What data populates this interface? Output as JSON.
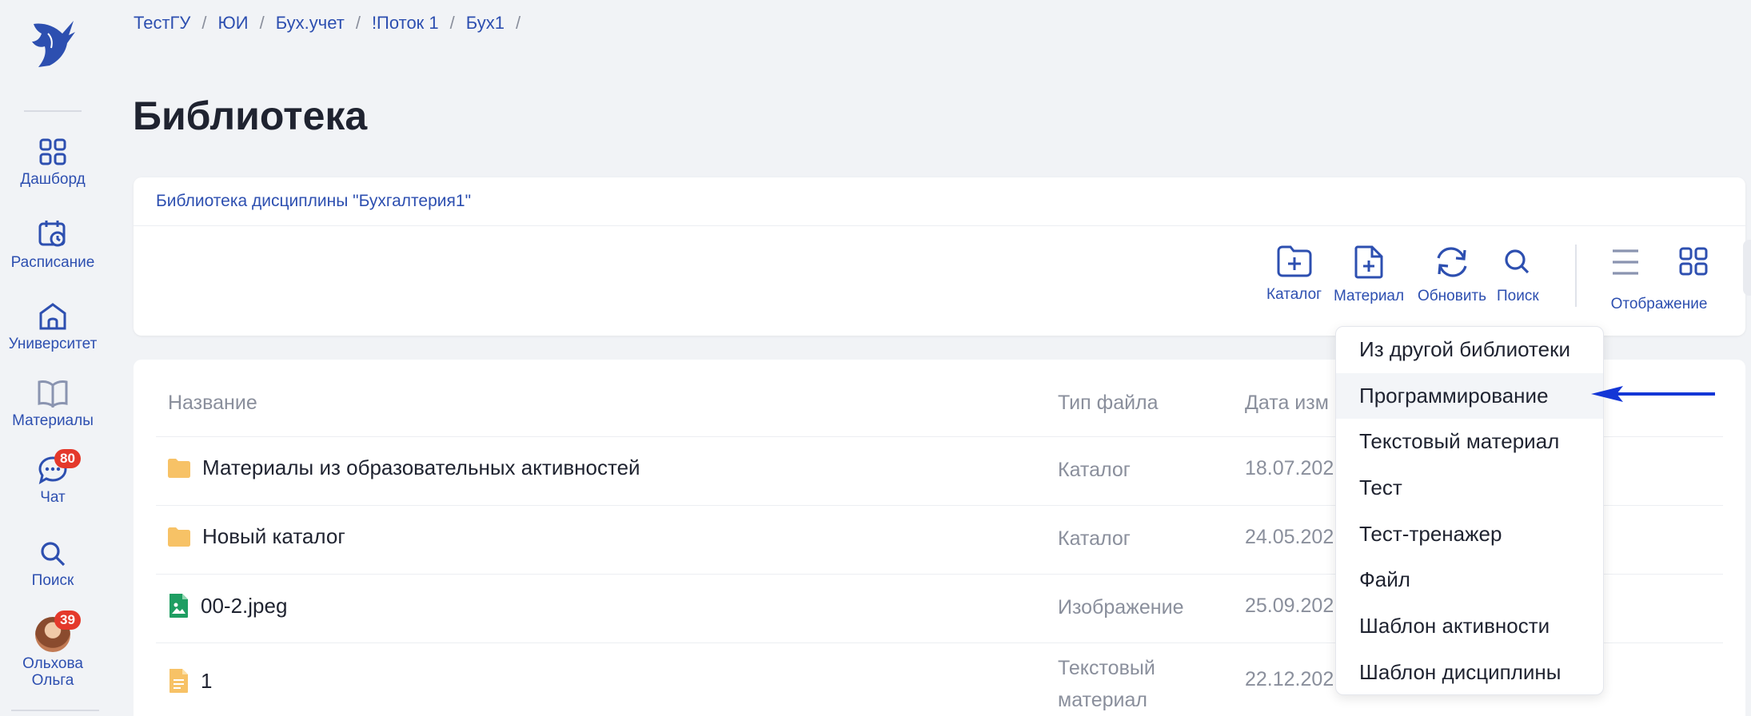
{
  "sidebar": {
    "items": [
      {
        "label": "Дашборд",
        "icon": "grid-icon"
      },
      {
        "label": "Расписание",
        "icon": "calendar-clock-icon"
      },
      {
        "label": "Университет",
        "icon": "university-icon"
      },
      {
        "label": "Материалы",
        "icon": "book-icon"
      },
      {
        "label": "Чат",
        "icon": "chat-icon",
        "badge": "80"
      },
      {
        "label": "Поиск",
        "icon": "search-icon"
      }
    ],
    "profile": {
      "name_line1": "Ольхова",
      "name_line2": "Ольга",
      "badge": "39"
    }
  },
  "breadcrumb": [
    "ТестГУ",
    "ЮИ",
    "Бух.учет",
    "!Поток 1",
    "Бух1"
  ],
  "breadcrumb_sep": "/",
  "page": {
    "title": "Библиотека"
  },
  "library": {
    "title": "Библиотека дисциплины \"Бухгалтерия1\""
  },
  "toolbar": {
    "catalog": "Каталог",
    "material": "Материал",
    "refresh": "Обновить",
    "search": "Поиск",
    "display": "Отображение"
  },
  "table": {
    "headers": {
      "name": "Название",
      "type": "Тип файла",
      "date": "Дата изм"
    },
    "rows": [
      {
        "name": "Материалы из образовательных активностей",
        "type_line1": "Каталог",
        "type_line2": "",
        "date": "18.07.202",
        "icon": "folder-icon"
      },
      {
        "name": "Новый каталог",
        "type_line1": "Каталог",
        "type_line2": "",
        "date": "24.05.202",
        "icon": "folder-icon"
      },
      {
        "name": "00-2.jpeg",
        "type_line1": "Изображение",
        "type_line2": "",
        "date": "25.09.202",
        "icon": "image-file-icon"
      },
      {
        "name": "1",
        "type_line1": "Текстовый",
        "type_line2": "материал",
        "date": "22.12.202",
        "icon": "text-file-icon"
      }
    ]
  },
  "dropdown": {
    "items": [
      "Из другой библиотеки",
      "Программирование",
      "Текстовый материал",
      "Тест",
      "Тест-тренажер",
      "Файл",
      "Шаблон активности",
      "Шаблон дисциплины"
    ],
    "highlighted_index": 1
  },
  "colors": {
    "accent": "#2d4fb0",
    "badge": "#e4392b",
    "folder": "#f7c266",
    "arrow": "#1336d6"
  }
}
